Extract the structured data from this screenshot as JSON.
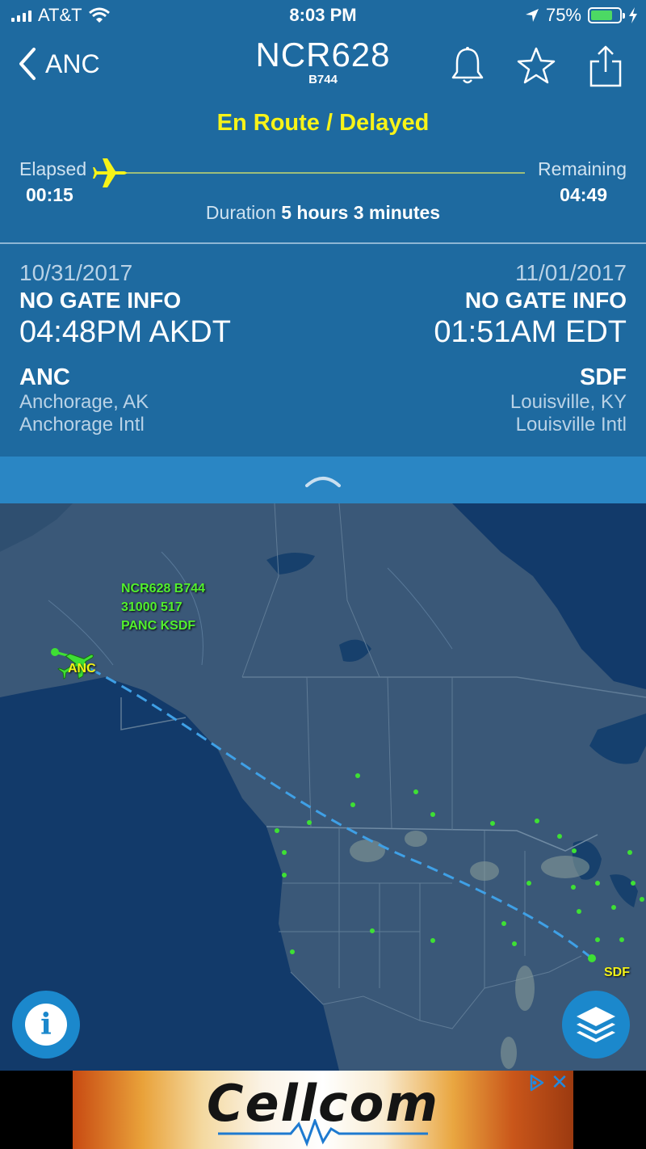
{
  "status_bar": {
    "carrier": "AT&T",
    "time": "8:03 PM",
    "battery_percent": "75%",
    "battery_level": 0.75
  },
  "nav": {
    "back_label": "ANC",
    "flight_number": "NCR628",
    "aircraft_type": "B744"
  },
  "flight": {
    "status": "En Route / Delayed",
    "elapsed_label": "Elapsed",
    "elapsed_value": "00:15",
    "remaining_label": "Remaining",
    "remaining_value": "04:49",
    "duration_label": "Duration",
    "duration_value": "5 hours 3 minutes",
    "progress_fraction": 0.05
  },
  "departure": {
    "date": "10/31/2017",
    "gate": "NO GATE INFO",
    "time": "04:48PM AKDT",
    "code": "ANC",
    "city": "Anchorage, AK",
    "airport": "Anchorage Intl"
  },
  "arrival": {
    "date": "11/01/2017",
    "gate": "NO GATE INFO",
    "time": "01:51AM EDT",
    "code": "SDF",
    "city": "Louisville, KY",
    "airport": "Louisville Intl"
  },
  "map": {
    "flight_tag_line1": "NCR628 B744",
    "flight_tag_line2": "31000 517",
    "flight_tag_line3": "PANC KSDF",
    "origin_label": "ANC",
    "destination_label": "SDF"
  },
  "ad": {
    "brand": "Cellcom"
  },
  "colors": {
    "header_blue": "#1e6aa0",
    "status_yellow": "#f7f318",
    "flight_green": "#52f02e",
    "route_line": "#3fa0e6",
    "fab_blue": "#1b88cc"
  },
  "icons": [
    "back-chevron-icon",
    "bell-icon",
    "star-icon",
    "share-icon",
    "airplane-icon",
    "collapse-chevron-icon",
    "info-icon",
    "layers-icon",
    "ad-choices-icon",
    "close-icon"
  ]
}
